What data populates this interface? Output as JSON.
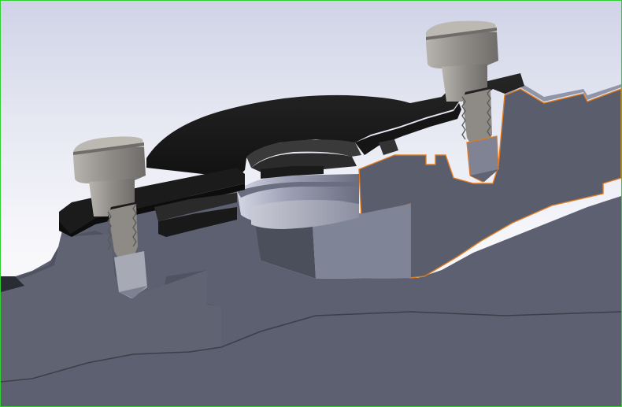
{
  "viewport": {
    "background_top": "#cfd3e6",
    "background_bottom": "#ffffff",
    "border_color": "#2fd02f",
    "selection_edge_color": "#e07a1f"
  },
  "model": {
    "view_mode": "section-view",
    "parts": [
      {
        "name": "housing",
        "color": "#6f737f",
        "section_color": "#5f6370"
      },
      {
        "name": "clamp-plate",
        "color": "#1c1c1c"
      },
      {
        "name": "cap-screw-left",
        "color": "#8a8886"
      },
      {
        "name": "cap-screw-right",
        "color": "#8a8886"
      },
      {
        "name": "bearing-ring",
        "color": "#8e92a6"
      }
    ]
  }
}
